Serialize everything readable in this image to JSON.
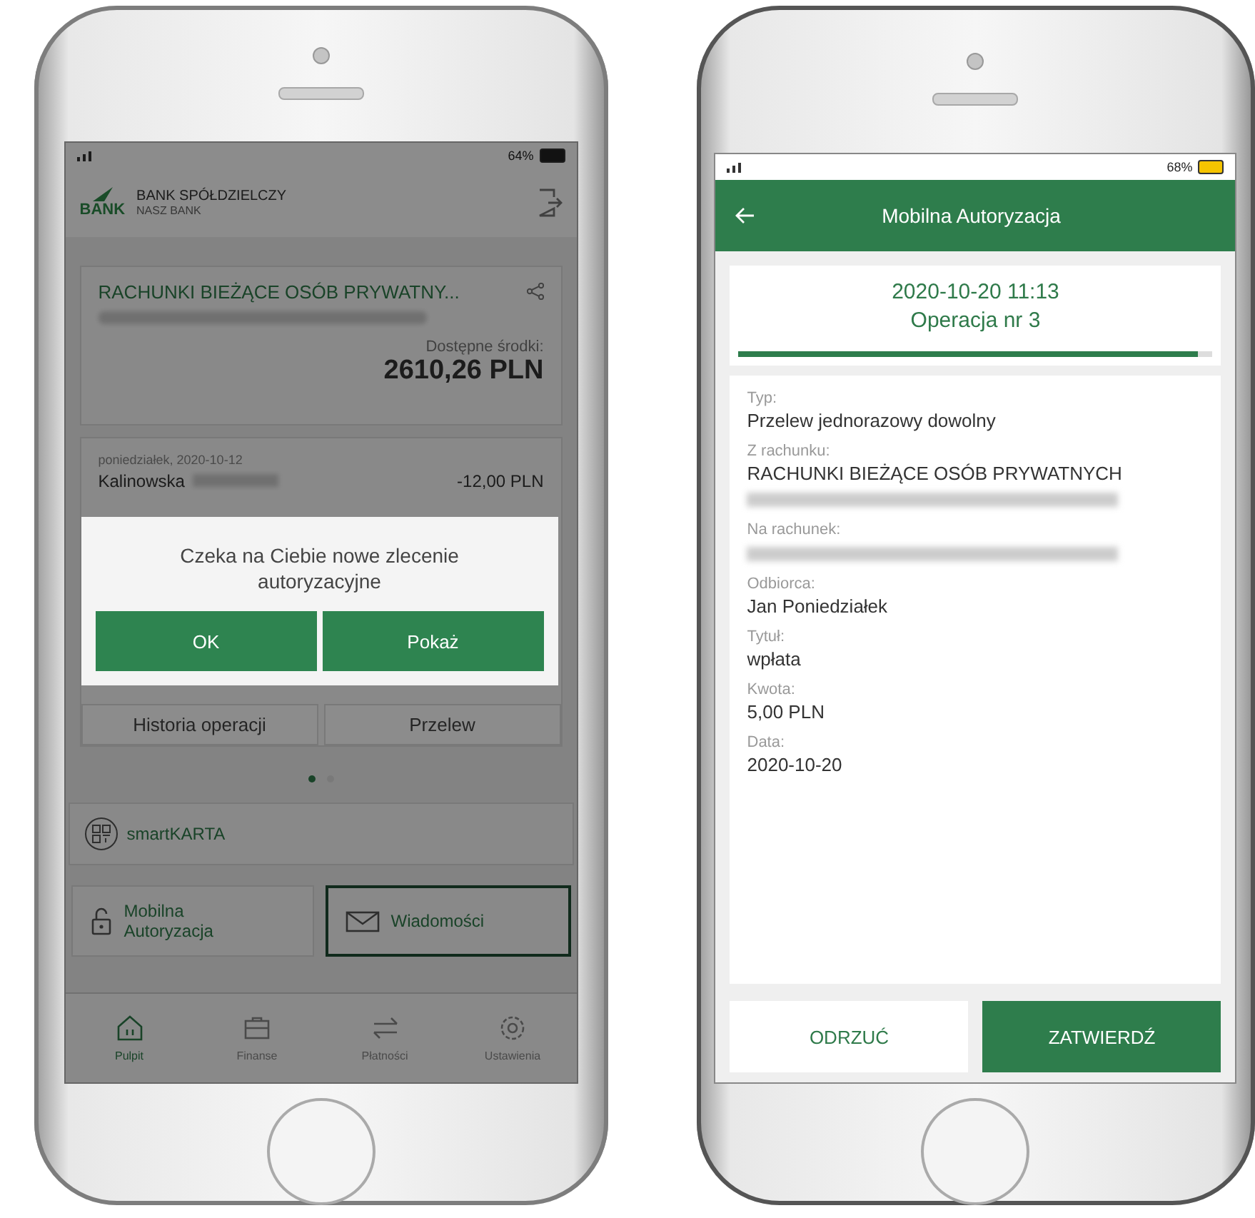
{
  "left_screen": {
    "status_bar": {
      "battery": "64%"
    },
    "header": {
      "logo_text": "BANK",
      "bank_name": "BANK SPÓŁDZIELCZY",
      "bank_subtitle": "NASZ BANK"
    },
    "account_card": {
      "name": "RACHUNKI BIEŻĄCE OSÓB PRYWATNY...",
      "number_masked": true,
      "available_label": "Dostępne środki:",
      "balance": "2610,26 PLN"
    },
    "transaction": {
      "date": "poniedziałek, 2020-10-12",
      "name": "Kalinowska",
      "name_masked": true,
      "amount": "-12,00 PLN"
    },
    "quick_actions": [
      "Historia operacji",
      "Przelew"
    ],
    "pager": [
      {
        "selected": true
      },
      {
        "selected": false
      }
    ],
    "smart_card": {
      "label": "smartKARTA"
    },
    "tiles": [
      {
        "label": "Mobilna Autoryzacja",
        "selected": false
      },
      {
        "label": "Wiadomości",
        "selected": true
      }
    ],
    "tab_bar": [
      {
        "label": "Pulpit",
        "selected": true
      },
      {
        "label": "Finanse",
        "selected": false
      },
      {
        "label": "Płatności",
        "selected": false
      },
      {
        "label": "Ustawienia",
        "selected": false
      }
    ],
    "dialog": {
      "message": "Czeka na Ciebie nowe zlecenie autoryzacyjne",
      "buttons": [
        "OK",
        "Pokaż"
      ]
    }
  },
  "right_screen": {
    "status_bar": {
      "battery": "68%"
    },
    "title": "Mobilna Autoryzacja",
    "date_time": "2020-10-20 11:13",
    "operation": "Operacja nr 3",
    "progress": {
      "level": 0.97
    },
    "fields": [
      {
        "label": "Typ:",
        "value": "Przelew jednorazowy dowolny"
      },
      {
        "label": "Z rachunku:",
        "value": "RACHUNKI BIEŻĄCE OSÓB PRYWATNYCH",
        "masked": true
      },
      {
        "label": "Na rachunek:",
        "masked": true
      },
      {
        "label": "Odbiorca:",
        "value": "Jan Poniedziałek"
      },
      {
        "label": "Tytuł:",
        "value": "wpłata"
      },
      {
        "label": "Kwota:",
        "value": "5,00 PLN"
      },
      {
        "label": "Data:",
        "value": "2020-10-20"
      }
    ],
    "buttons": [
      {
        "label": "ODRZUĆ",
        "kind": "secondary"
      },
      {
        "label": "ZATWIERDŹ",
        "kind": "primary"
      }
    ]
  }
}
